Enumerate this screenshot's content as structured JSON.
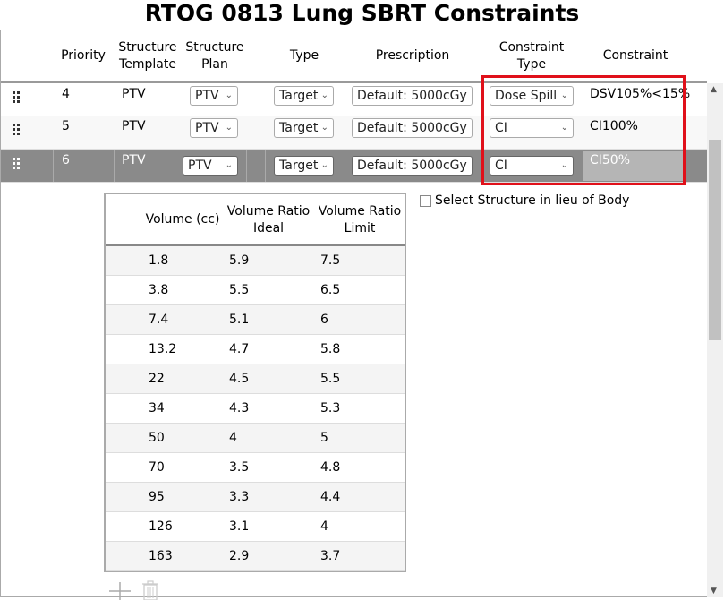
{
  "title": "RTOG 0813 Lung SBRT Constraints",
  "headers": {
    "priority": "Priority",
    "structure_template": [
      "Structure",
      "Template"
    ],
    "structure_plan": [
      "Structure",
      "Plan"
    ],
    "type": "Type",
    "prescription": "Prescription",
    "constraint_type": [
      "Constraint",
      "Type"
    ],
    "constraint": "Constraint"
  },
  "rows": [
    {
      "priority": "4",
      "structure": "PTV",
      "plan": "PTV",
      "type": "Target",
      "prescription": "Default: 5000cGy",
      "constraint_type": "Dose Spill",
      "constraint": "DSV105%<15%"
    },
    {
      "priority": "5",
      "structure": "PTV",
      "plan": "PTV",
      "type": "Target",
      "prescription": "Default: 5000cGy",
      "constraint_type": "CI",
      "constraint": "CI100%"
    },
    {
      "priority": "6",
      "structure": "PTV",
      "plan": "PTV",
      "type": "Target",
      "prescription": "Default: 5000cGy",
      "constraint_type": "CI",
      "constraint": "CI50%"
    }
  ],
  "detail_table": {
    "headers": {
      "volume": "Volume (cc)",
      "ideal": [
        "Volume Ratio",
        "Ideal"
      ],
      "limit": [
        "Volume Ratio",
        "Limit"
      ]
    },
    "rows": [
      [
        "1.8",
        "5.9",
        "7.5"
      ],
      [
        "3.8",
        "5.5",
        "6.5"
      ],
      [
        "7.4",
        "5.1",
        "6"
      ],
      [
        "13.2",
        "4.7",
        "5.8"
      ],
      [
        "22",
        "4.5",
        "5.5"
      ],
      [
        "34",
        "4.3",
        "5.3"
      ],
      [
        "50",
        "4",
        "5"
      ],
      [
        "70",
        "3.5",
        "4.8"
      ],
      [
        "95",
        "3.3",
        "4.4"
      ],
      [
        "126",
        "3.1",
        "4"
      ],
      [
        "163",
        "2.9",
        "3.7"
      ]
    ]
  },
  "select_structure_label": "Select Structure in lieu of Body",
  "colors": {
    "highlight": "#e0101a",
    "selected_row": "#8a8a8a"
  }
}
